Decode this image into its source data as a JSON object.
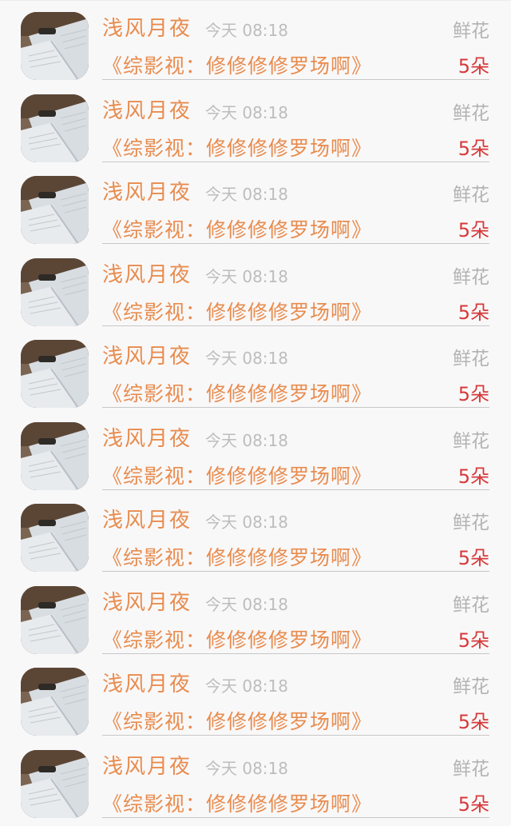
{
  "records": [
    {
      "name": "浅风月夜",
      "time": "今天 08:18",
      "gift_label": "鲜花",
      "book_title": "《综影视：修修修修罗场啊》",
      "amount": "5朵",
      "avatar_icon": "open-book-avatar"
    },
    {
      "name": "浅风月夜",
      "time": "今天 08:18",
      "gift_label": "鲜花",
      "book_title": "《综影视：修修修修罗场啊》",
      "amount": "5朵",
      "avatar_icon": "open-book-avatar"
    },
    {
      "name": "浅风月夜",
      "time": "今天 08:18",
      "gift_label": "鲜花",
      "book_title": "《综影视：修修修修罗场啊》",
      "amount": "5朵",
      "avatar_icon": "open-book-avatar"
    },
    {
      "name": "浅风月夜",
      "time": "今天 08:18",
      "gift_label": "鲜花",
      "book_title": "《综影视：修修修修罗场啊》",
      "amount": "5朵",
      "avatar_icon": "open-book-avatar"
    },
    {
      "name": "浅风月夜",
      "time": "今天 08:18",
      "gift_label": "鲜花",
      "book_title": "《综影视：修修修修罗场啊》",
      "amount": "5朵",
      "avatar_icon": "open-book-avatar"
    },
    {
      "name": "浅风月夜",
      "time": "今天 08:18",
      "gift_label": "鲜花",
      "book_title": "《综影视：修修修修罗场啊》",
      "amount": "5朵",
      "avatar_icon": "open-book-avatar"
    },
    {
      "name": "浅风月夜",
      "time": "今天 08:18",
      "gift_label": "鲜花",
      "book_title": "《综影视：修修修修罗场啊》",
      "amount": "5朵",
      "avatar_icon": "open-book-avatar"
    },
    {
      "name": "浅风月夜",
      "time": "今天 08:18",
      "gift_label": "鲜花",
      "book_title": "《综影视：修修修修罗场啊》",
      "amount": "5朵",
      "avatar_icon": "open-book-avatar"
    },
    {
      "name": "浅风月夜",
      "time": "今天 08:18",
      "gift_label": "鲜花",
      "book_title": "《综影视：修修修修罗场啊》",
      "amount": "5朵",
      "avatar_icon": "open-book-avatar"
    },
    {
      "name": "浅风月夜",
      "time": "今天 08:18",
      "gift_label": "鲜花",
      "book_title": "《综影视：修修修修罗场啊》",
      "amount": "5朵",
      "avatar_icon": "open-book-avatar"
    }
  ],
  "colors": {
    "name": "#e88c4e",
    "book_title": "#e88c4e",
    "time": "#bdbdbd",
    "gift_label": "#b3b3b3",
    "amount": "#d63a3a",
    "background": "#f9f8f9"
  }
}
